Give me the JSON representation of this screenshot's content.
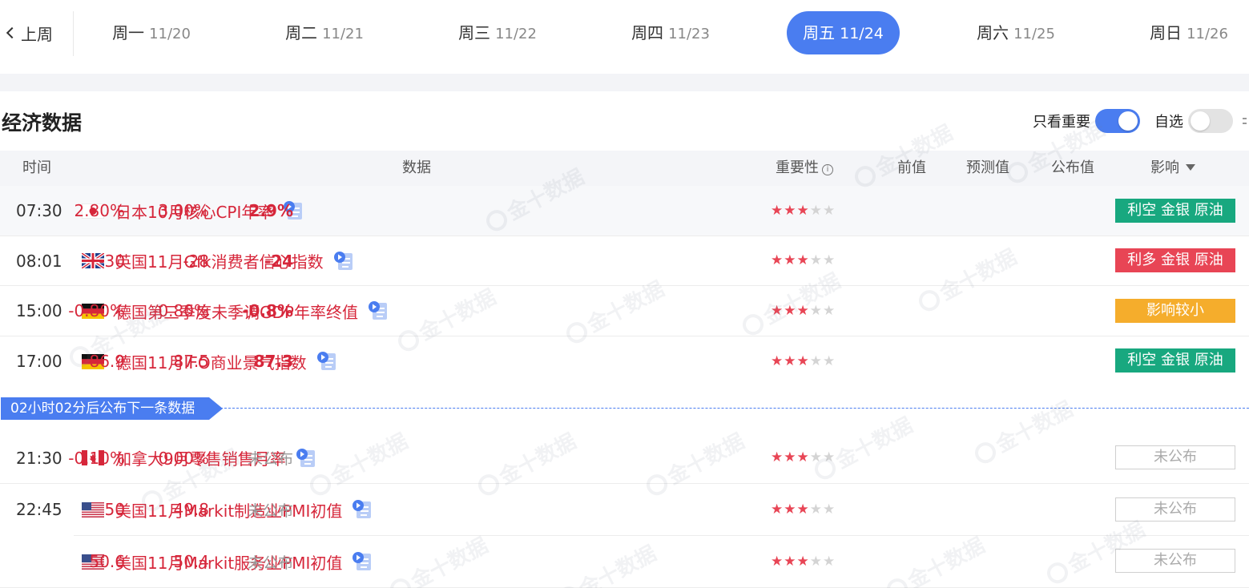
{
  "week_nav": {
    "prev_label": "上周",
    "days": [
      {
        "weekday": "周一",
        "date": "11/20",
        "active": false
      },
      {
        "weekday": "周二",
        "date": "11/21",
        "active": false
      },
      {
        "weekday": "周三",
        "date": "11/22",
        "active": false
      },
      {
        "weekday": "周四",
        "date": "11/23",
        "active": false
      },
      {
        "weekday": "周五",
        "date": "11/24",
        "active": true
      },
      {
        "weekday": "周六",
        "date": "11/25",
        "active": false
      },
      {
        "weekday": "周日",
        "date": "11/26",
        "active": false
      }
    ]
  },
  "section": {
    "title": "经济数据",
    "filters": [
      {
        "label": "只看重要",
        "on": true
      },
      {
        "label": "自选",
        "on": false
      }
    ]
  },
  "table": {
    "headers": {
      "time": "时间",
      "data": "数据",
      "importance": "重要性",
      "previous": "前值",
      "forecast": "预测值",
      "actual": "公布值",
      "impact": "影响"
    },
    "rows": [
      {
        "time": "07:30",
        "flag": "japan-flag",
        "name": "日本10月核心CPI年率",
        "stars": 3,
        "previous": "2.80%",
        "forecast": "3.00%",
        "actual": "2.9%",
        "impact": "利空 金银 原油",
        "impact_type": "green"
      },
      {
        "time": "08:01",
        "flag": "uk-flag",
        "name": "英国11月Gfk消费者信心指数",
        "stars": 3,
        "previous": "-30",
        "forecast": "-28",
        "actual": "-24",
        "impact": "利多 金银 原油",
        "impact_type": "red"
      },
      {
        "time": "15:00",
        "flag": "germany-flag",
        "name": "德国第三季度未季调GDP年率终值",
        "stars": 3,
        "previous": "-0.80%",
        "forecast": "-0.80%",
        "actual": "-0.8%",
        "impact": "影响较小",
        "impact_type": "orange"
      },
      {
        "time": "17:00",
        "flag": "germany-flag",
        "name": "德国11月IFO商业景气指数",
        "stars": 3,
        "previous": "86.9",
        "forecast": "87.5",
        "actual": "87.3",
        "impact": "利空 金银 原油",
        "impact_type": "green"
      }
    ],
    "countdown": "02小时02分后公布下一条数据",
    "pending_rows": [
      {
        "time": "21:30",
        "flag": "canada-flag",
        "name": "加拿大9月零售销售月率",
        "stars": 3,
        "previous": "-0.10%",
        "forecast": "0.00%",
        "actual": "未公布",
        "impact": "未公布"
      },
      {
        "time": "22:45",
        "flag": "us-flag",
        "name": "美国11月Markit制造业PMI初值",
        "stars": 3,
        "previous": "50",
        "forecast": "49.8",
        "actual": "未公布",
        "impact": "未公布"
      },
      {
        "time": "",
        "flag": "us-flag",
        "name": "美国11月Markit服务业PMI初值",
        "stars": 3,
        "previous": "50.6",
        "forecast": "50.4",
        "actual": "未公布",
        "impact": "未公布"
      }
    ]
  },
  "watermark_text": "金十数据",
  "colors": {
    "accent": "#4a7df0",
    "value_red": "#d6263a",
    "star_on": "#e84555",
    "bearish_green": "#18a87f",
    "bullish_red": "#e84555",
    "neutral_orange": "#f5ad2c"
  }
}
